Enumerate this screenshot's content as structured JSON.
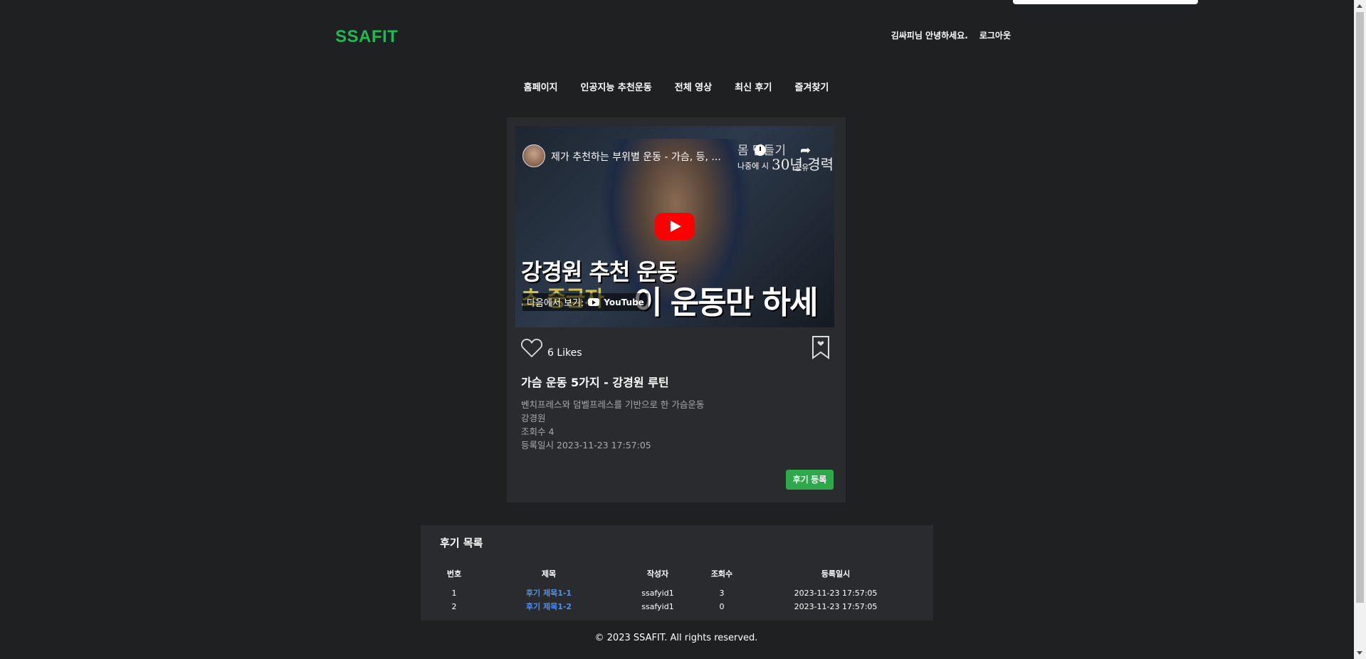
{
  "header": {
    "logo": "SSAFIT",
    "greeting": "김싸피님 안녕하세요.",
    "logout": "로그아웃"
  },
  "nav": {
    "items": [
      {
        "label": "홈페이지"
      },
      {
        "label": "인공지능 추천운동"
      },
      {
        "label": "전체 영상"
      },
      {
        "label": "최신 후기"
      },
      {
        "label": "즐겨찾기"
      }
    ]
  },
  "video": {
    "embed_title": "제가 추천하는 부위별 운동 - 가슴, 등, ...",
    "overlay_text": "몸 만들기",
    "later_text": "나중에 시",
    "overlay_30": "30년 경력",
    "share_text": "공유",
    "thumb_line1": "강경원 추천 운동",
    "thumb_line2": "초 중급자",
    "thumb_line3": "이 운동만 하세요",
    "watch_on": "다음에서 보기:",
    "youtube": "YouTube",
    "likes": "6 Likes",
    "title": "가슴 운동 5가지 - 강경원 루틴",
    "description": "벤치프레스와 덤벨프레스를 기반으로 한 가슴운동",
    "channel": "강경원",
    "views": "조회수 4",
    "registered": "등록일시 2023-11-23 17:57:05",
    "review_button": "후기 등록"
  },
  "reviews": {
    "heading": "후기 목록",
    "columns": [
      "번호",
      "제목",
      "작성자",
      "조회수",
      "등록일시"
    ],
    "rows": [
      {
        "no": "1",
        "title": "후기 제목1-1",
        "author": "ssafyid1",
        "views": "3",
        "date": "2023-11-23 17:57:05"
      },
      {
        "no": "2",
        "title": "후기 제목1-2",
        "author": "ssafyid1",
        "views": "0",
        "date": "2023-11-23 17:57:05"
      }
    ]
  },
  "footer": {
    "text": "© 2023 SSAFIT. All rights reserved."
  },
  "colors": {
    "background": "#1f2022",
    "card": "#2a2b2e",
    "logo": "#1db954",
    "accent_button": "#2ea84a",
    "link": "#4e8ff0"
  }
}
